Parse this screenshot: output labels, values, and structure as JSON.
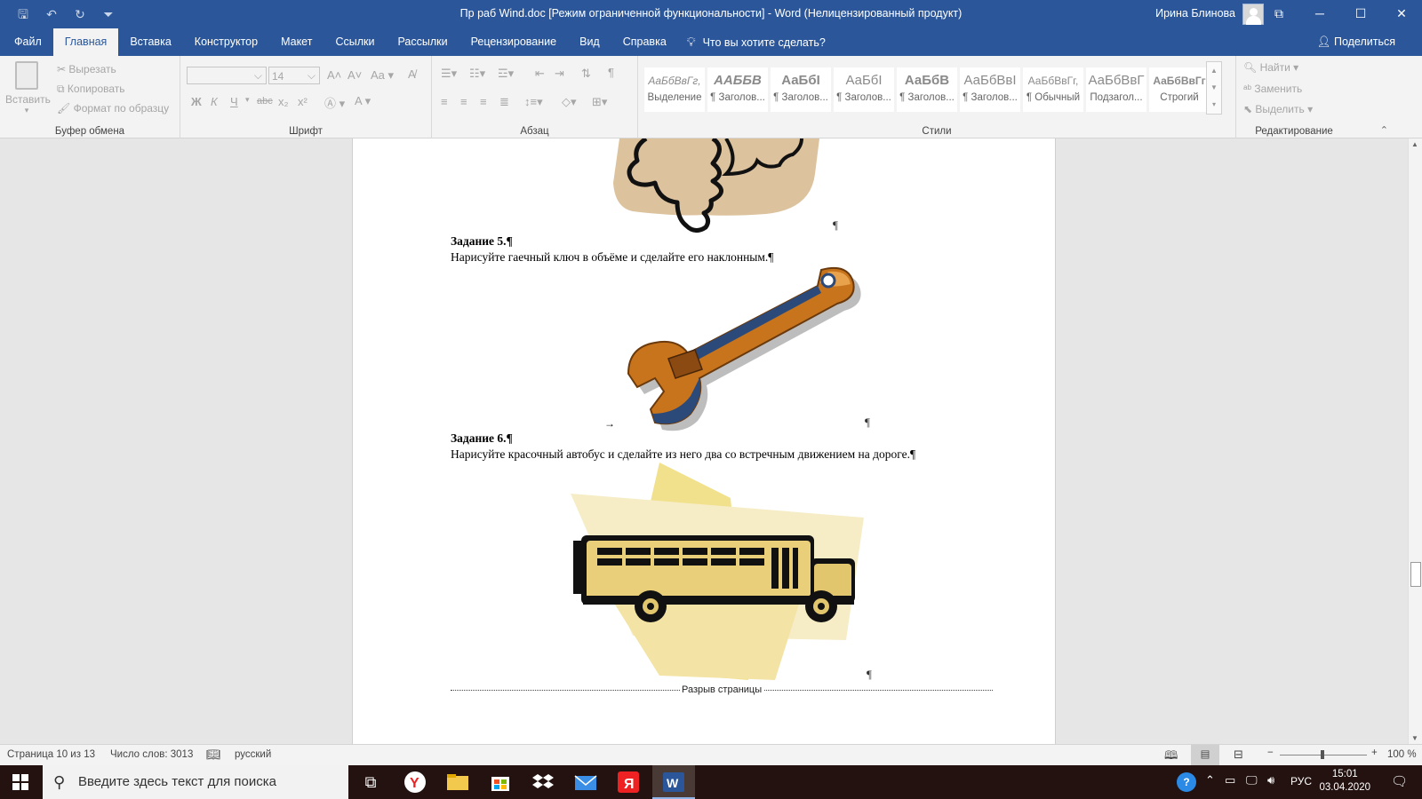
{
  "titlebar": {
    "title": "Пр раб Wind.doc [Режим ограниченной функциональности]  -  Word (Нелицензированный продукт)",
    "user": "Ирина Блинова",
    "controls": [
      "─",
      "☐",
      "✕"
    ]
  },
  "menu": {
    "tabs": [
      "Файл",
      "Главная",
      "Вставка",
      "Конструктор",
      "Макет",
      "Ссылки",
      "Рассылки",
      "Рецензирование",
      "Вид",
      "Справка"
    ],
    "active_tab": "Главная",
    "tellme": "Что вы хотите сделать?",
    "share": "Поделиться"
  },
  "ribbon": {
    "clipboard": {
      "paste": "Вставить",
      "cut": "Вырезать",
      "copy": "Копировать",
      "format_painter": "Формат по образцу",
      "label": "Буфер обмена"
    },
    "font": {
      "size": "14",
      "bold": "Ж",
      "italic": "К",
      "underline": "Ч",
      "strike": "abc",
      "sub": "x₂",
      "sup": "x²",
      "case": "Aa",
      "label": "Шрифт"
    },
    "paragraph": {
      "label": "Абзац"
    },
    "styles": {
      "label": "Стили",
      "items": [
        {
          "preview": "АаБбВвГг,",
          "name": "Выделение"
        },
        {
          "preview": "ААББВ",
          "name": "¶ Заголов..."
        },
        {
          "preview": "АаБбІ",
          "name": "¶ Заголов..."
        },
        {
          "preview": "АаБбІ",
          "name": "¶ Заголов..."
        },
        {
          "preview": "АаБбВ",
          "name": "¶ Заголов..."
        },
        {
          "preview": "АаБбВвІ",
          "name": "¶ Заголов..."
        },
        {
          "preview": "АаБбВвГг,",
          "name": "¶ Обычный"
        },
        {
          "preview": "АаБбВвГ",
          "name": "Подзагол..."
        },
        {
          "preview": "АаБбВвГг",
          "name": "Строгий"
        }
      ]
    },
    "editing": {
      "find": "Найти",
      "replace": "Заменить",
      "select": "Выделить",
      "label": "Редактирование"
    }
  },
  "document": {
    "task5_title": "Задание 5.¶",
    "task5_text": "Нарисуйте гаечный ключ в объёме и сделайте его наклонным.¶",
    "task6_title": "Задание 6.¶",
    "task6_text": "Нарисуйте красочный автобус и сделайте из него два со встречным движением на дороге.¶",
    "pilcrow": "¶",
    "tab_arrow": "→",
    "page_break": "Разрыв страницы"
  },
  "status": {
    "page": "Страница 10 из 13",
    "words": "Число слов: 3013",
    "lang": "русский",
    "zoom": "100 %"
  },
  "taskbar": {
    "search_placeholder": "Введите здесь текст для поиска",
    "lang": "РУС",
    "time": "15:01",
    "date": "03.04.2020"
  },
  "colors": {
    "accent": "#2b579a",
    "taskbar": "#23120f"
  }
}
